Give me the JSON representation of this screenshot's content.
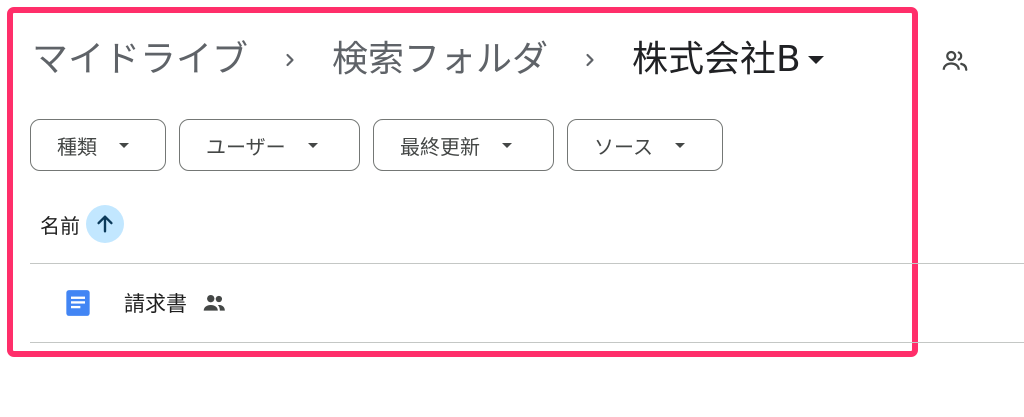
{
  "breadcrumb": {
    "items": [
      "マイドライブ",
      "検索フォルダ"
    ],
    "current": "株式会社B"
  },
  "filters": [
    {
      "label": "種類"
    },
    {
      "label": "ユーザー"
    },
    {
      "label": "最終更新"
    },
    {
      "label": "ソース"
    }
  ],
  "list": {
    "sort_column": "名前",
    "sort_direction": "ascending",
    "files": [
      {
        "name": "請求書",
        "type": "google-doc",
        "shared": true
      }
    ]
  },
  "colors": {
    "highlight": "#ff2e6a",
    "sort_button_bg": "#c2e7ff",
    "doc_icon": "#4285f4"
  },
  "icons": {
    "breadcrumb_separator": "chevron-right-icon",
    "current_folder_menu": "caret-down-icon",
    "shared_folder": "shared-people-icon",
    "sort": "arrow-up-icon",
    "file": "google-docs-icon"
  }
}
